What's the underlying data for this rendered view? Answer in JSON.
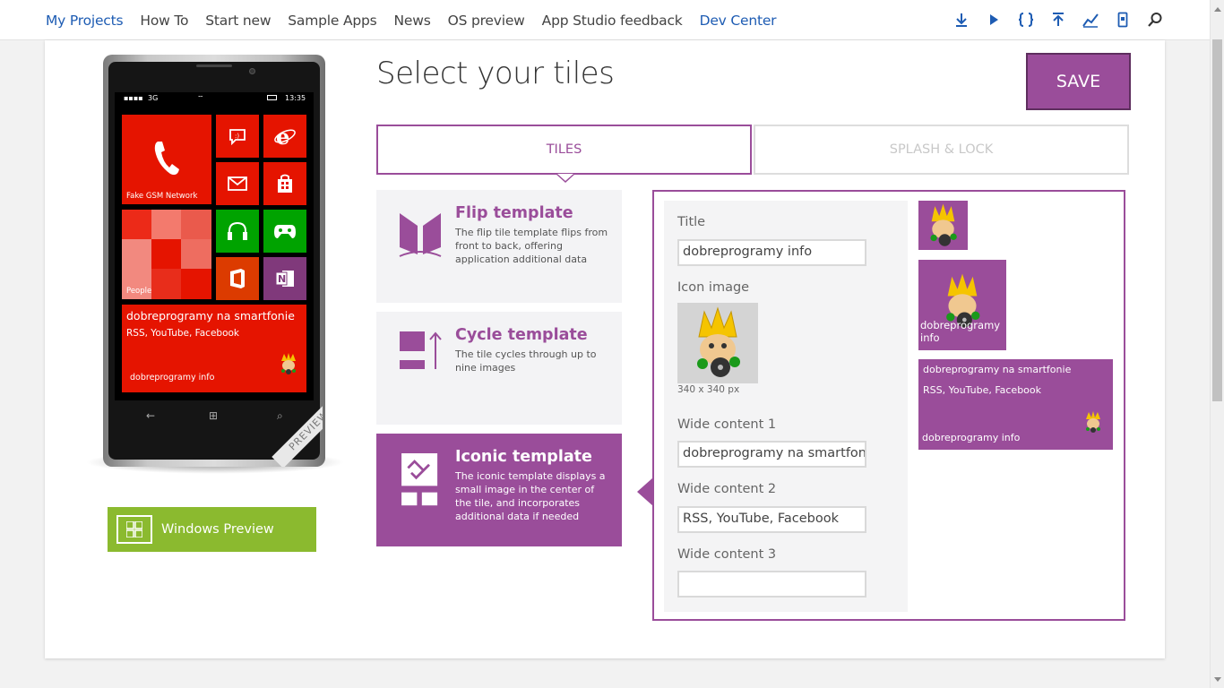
{
  "nav": {
    "links": [
      "My Projects",
      "How To",
      "Start new",
      "Sample Apps",
      "News",
      "OS preview",
      "App Studio feedback",
      "Dev Center"
    ],
    "icons": [
      "download-icon",
      "play-icon",
      "code-braces-icon",
      "publish-icon",
      "analytics-icon",
      "phone-icon",
      "search-icon"
    ]
  },
  "phone": {
    "status": {
      "signal": "▪▪▪▪",
      "network": "3G",
      "time": "13:35"
    },
    "tiles": {
      "phone_label": "Fake GSM Network",
      "people_label": "People",
      "wide_line1": "dobreprogramy na smartfonie",
      "wide_line2": "RSS, YouTube, Facebook",
      "wide_line3": "dobreprogramy info"
    },
    "ribbon": "PREVIEW"
  },
  "windows_preview": {
    "label": "Windows Preview"
  },
  "page": {
    "title": "Select your tiles",
    "save_label": "SAVE"
  },
  "tabs": [
    {
      "label": "TILES",
      "active": true
    },
    {
      "label": "SPLASH & LOCK",
      "active": false
    }
  ],
  "templates": [
    {
      "title": "Flip template",
      "desc": "The flip tile template flips from front to back, offering application additional data",
      "selected": false
    },
    {
      "title": "Cycle template",
      "desc": "The tile cycles through up to nine images",
      "selected": false
    },
    {
      "title": "Iconic template",
      "desc": "The iconic template displays a small image in the center of the tile, and incorporates additional data if needed",
      "selected": true
    }
  ],
  "form": {
    "title_label": "Title",
    "title_value": "dobreprogramy info",
    "icon_label": "Icon image",
    "icon_size": "340 x 340 px",
    "wide1_label": "Wide content 1",
    "wide1_value": "dobreprogramy na smartfonie",
    "wide2_label": "Wide content 2",
    "wide2_value": "RSS, YouTube, Facebook",
    "wide3_label": "Wide content 3",
    "wide3_value": ""
  },
  "preview": {
    "medium_label": "dobreprogramy info",
    "wide_line1": "dobreprogramy na smartfonie",
    "wide_line2": "RSS, YouTube, Facebook",
    "wide_line3": "dobreprogramy info"
  },
  "colors": {
    "accent": "#9a4d9a",
    "tile_red": "#e51400",
    "windows_green": "#8bba2f",
    "link_blue": "#1e5cb3"
  }
}
